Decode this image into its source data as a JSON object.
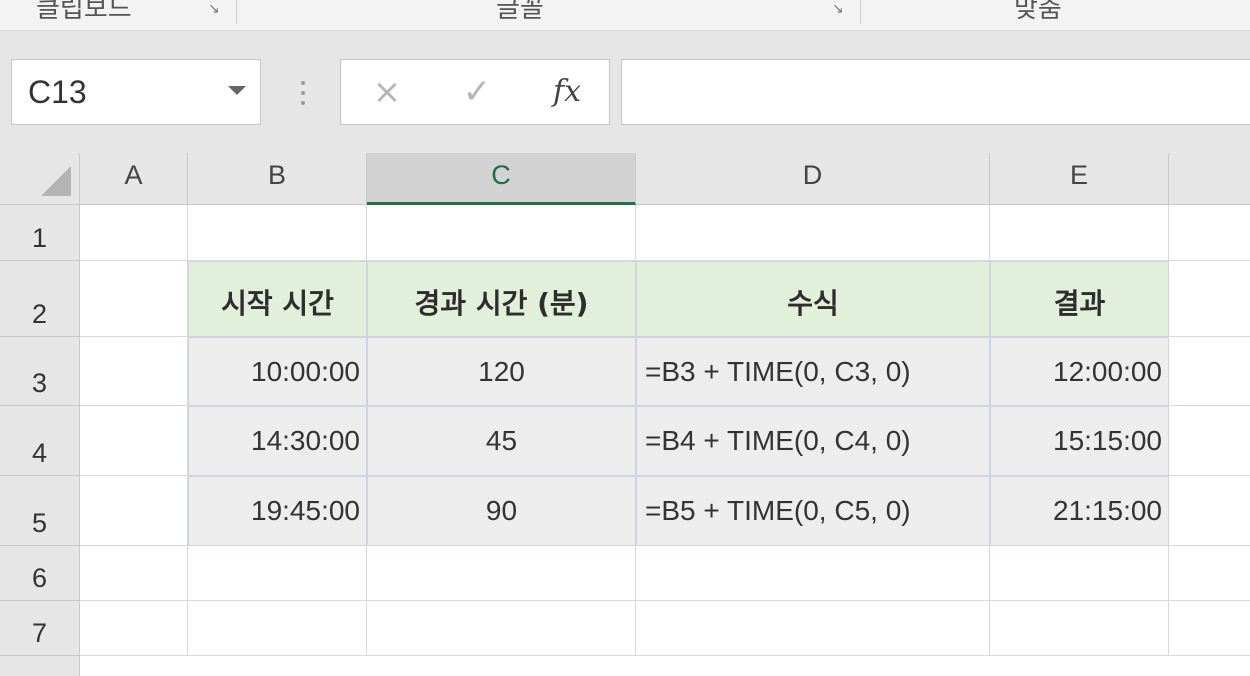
{
  "ribbon": {
    "groups": [
      {
        "label": "클립보드"
      },
      {
        "label": "글꼴"
      },
      {
        "label": "맞춤"
      }
    ]
  },
  "formula_bar": {
    "name_box": "C13",
    "cancel_icon": "×",
    "enter_icon": "✓",
    "fx_icon": "fx",
    "formula": ""
  },
  "columns": [
    "A",
    "B",
    "C",
    "D",
    "E"
  ],
  "selected_column": "C",
  "rows": [
    "1",
    "2",
    "3",
    "4",
    "5",
    "6",
    "7"
  ],
  "table": {
    "headers": [
      "시작 시간",
      "경과 시간 (분)",
      "수식",
      "결과"
    ],
    "rows": [
      [
        "10:00:00",
        "120",
        "=B3 + TIME(0, C3, 0)",
        "12:00:00"
      ],
      [
        "14:30:00",
        "45",
        "=B4 + TIME(0, C4, 0)",
        "15:15:00"
      ],
      [
        "19:45:00",
        "90",
        "=B5 + TIME(0, C5, 0)",
        "21:15:00"
      ]
    ]
  },
  "colors": {
    "header_fill": "#e2efda",
    "data_fill": "#ededed",
    "selection_accent": "#217346"
  }
}
